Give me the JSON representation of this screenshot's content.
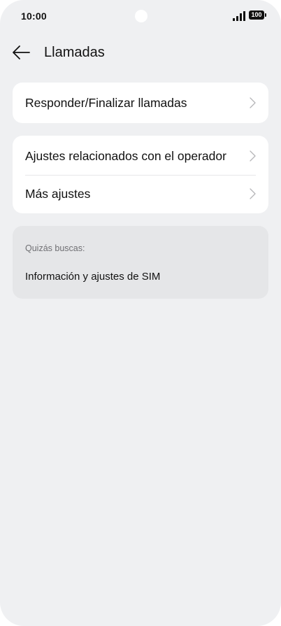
{
  "status_bar": {
    "time": "10:00",
    "battery": "100",
    "signal_icon": "signal-icon",
    "battery_icon": "battery-icon"
  },
  "header": {
    "title": "Llamadas",
    "back_icon": "arrow-left-icon"
  },
  "sections": [
    {
      "items": [
        {
          "label": "Responder/Finalizar llamadas",
          "icon": "chevron-right-icon"
        }
      ]
    },
    {
      "items": [
        {
          "label": "Ajustes relacionados con el operador",
          "icon": "chevron-right-icon"
        },
        {
          "label": "Más ajustes",
          "icon": "chevron-right-icon"
        }
      ]
    }
  ],
  "suggestions": {
    "heading": "Quizás buscas:",
    "items": [
      {
        "label": "Información y ajustes de SIM"
      }
    ]
  },
  "colors": {
    "background": "#eff0f2",
    "card": "#ffffff",
    "suggestion_card": "#e5e6e8",
    "text": "#111111",
    "secondary_text": "#6f6f73"
  }
}
